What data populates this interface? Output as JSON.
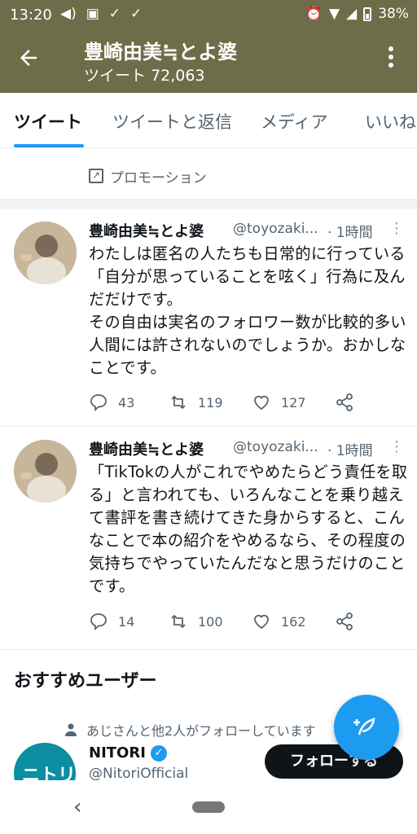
{
  "status_bar": {
    "time": "13:20",
    "battery": "38%"
  },
  "header": {
    "back_icon": "arrow-left-icon",
    "name": "豊崎由美≒とよ婆",
    "tweet_count_label": "ツイート 72,063",
    "more_icon": "more-vertical-icon",
    "background_color": "#6e6d49"
  },
  "tabs": [
    {
      "label": "ツイート",
      "active": true
    },
    {
      "label": "ツイートと返信",
      "active": false
    },
    {
      "label": "メディア",
      "active": false
    },
    {
      "label": "いいね",
      "active": false
    }
  ],
  "promotion": {
    "label": "プロモーション"
  },
  "tweets": [
    {
      "name": "豊崎由美≒とよ婆",
      "handle": "@toyozaki...",
      "time": "· 1時間",
      "text": "わたしは匿名の人たちも日常的に行っている「自分が思っていることを呟く」行為に及んだだけです。\nその自由は実名のフォロワー数が比較的多い人間には許されないのでしょうか。おかしなことです。",
      "replies": "43",
      "retweets": "119",
      "likes": "127"
    },
    {
      "name": "豊崎由美≒とよ婆",
      "handle": "@toyozaki...",
      "time": "· 1時間",
      "text": "「TikTokの人がこれでやめたらどう責任を取る」と言われても、いろんなことを乗り越えて書評を書き続けてきた身からすると、こんなことで本の紹介をやめるなら、その程度の気持ちでやっていたんだなと思うだけのことです。",
      "replies": "14",
      "retweets": "100",
      "likes": "162"
    }
  ],
  "recommended": {
    "title": "おすすめユーザー",
    "context": "あじさんと他2人がフォローしています",
    "user": {
      "name": "NITORI",
      "handle": "@NitoriOfficial",
      "avatar_text": "ニトリ",
      "verified": true
    },
    "follow_label": "フォローする"
  },
  "accent_color": "#1d9bf0"
}
